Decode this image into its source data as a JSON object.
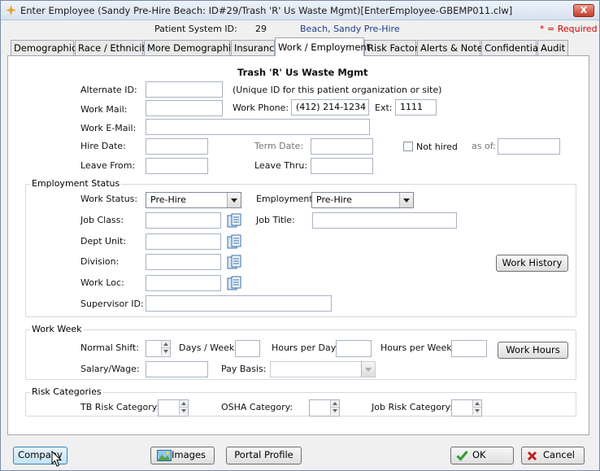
{
  "window": {
    "title": "Enter Employee (Sandy Pre-Hire Beach: ID#29/Trash 'R' Us Waste Mgmt)[EnterEmployee-GBEMP011.clw]",
    "close_label": "X"
  },
  "header": {
    "patient_system_id_label": "Patient System ID:",
    "patient_system_id": "29",
    "patient_name": "Beach, Sandy Pre-Hire",
    "required_note": "* = Required"
  },
  "tabs": [
    {
      "label": "Demographics"
    },
    {
      "label": "Race / Ethnicity"
    },
    {
      "label": "More Demographics"
    },
    {
      "label": "Insurance"
    },
    {
      "label": "Work / Employment",
      "active": true
    },
    {
      "label": "Risk Factors"
    },
    {
      "label": "Alerts & Notes"
    },
    {
      "label": "Confidential"
    },
    {
      "label": "Audit"
    }
  ],
  "form": {
    "org_name": "Trash 'R' Us Waste Mgmt",
    "alternate_id_label": "Alternate ID:",
    "alternate_id_value": "",
    "alternate_id_hint": "(Unique ID for this patient organization or site)",
    "work_mail_label": "Work Mail:",
    "work_mail_value": "",
    "work_phone_label": "Work Phone:",
    "work_phone_value": "(412) 214-1234",
    "ext_label": "Ext:",
    "ext_value": "1111",
    "work_email_label": "Work E-Mail:",
    "work_email_value": "",
    "hire_date_label": "Hire Date:",
    "term_date_label": "Term Date:",
    "not_hired_label": "Not hired",
    "as_of_label": "as of:",
    "leave_from_label": "Leave From:",
    "leave_thru_label": "Leave Thru:"
  },
  "employment_status": {
    "title": "Employment Status",
    "work_status_label": "Work Status:",
    "work_status_value": "Pre-Hire",
    "employment_label": "Employment:",
    "employment_value": "Pre-Hire",
    "job_class_label": "Job Class:",
    "job_title_label": "Job Title:",
    "dept_unit_label": "Dept Unit:",
    "division_label": "Division:",
    "work_loc_label": "Work Loc:",
    "supervisor_id_label": "Supervisor ID:",
    "work_history_button": "Work History"
  },
  "work_week": {
    "title": "Work Week",
    "normal_shift_label": "Normal Shift:",
    "days_per_week_label": "Days / Week:",
    "hours_per_day_label": "Hours per Day:",
    "hours_per_week_label": "Hours per Week:",
    "work_hours_button": "Work Hours",
    "salary_wage_label": "Salary/Wage:",
    "pay_basis_label": "Pay Basis:"
  },
  "risk_categories": {
    "title": "Risk Categories",
    "tb_label": "TB Risk Category:",
    "osha_label": "OSHA Category:",
    "job_risk_label": "Job Risk Category:"
  },
  "footer": {
    "company_button": "Company",
    "images_button": "Images",
    "portal_profile_button": "Portal Profile",
    "ok_button": "OK",
    "cancel_button": "Cancel"
  },
  "colors": {
    "required": "#d00000",
    "patient_name": "#1f3c88",
    "ok_check": "#2e9b2e",
    "cancel_x": "#c0201e"
  }
}
